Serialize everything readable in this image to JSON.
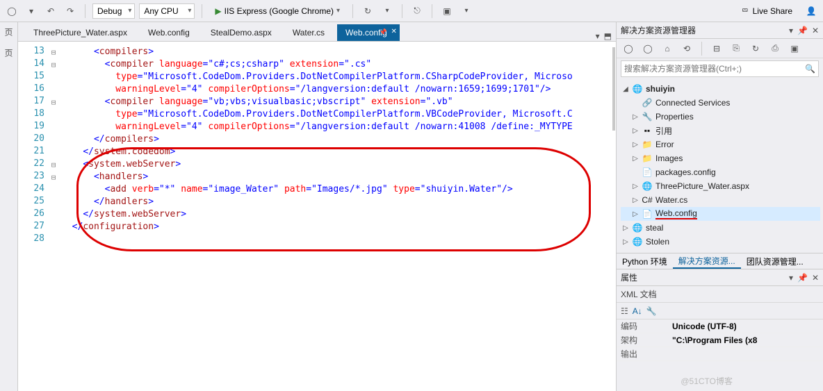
{
  "toolbar": {
    "config": "Debug",
    "platform": "Any CPU",
    "start_label": "IIS Express (Google Chrome)",
    "liveshare": "Live Share"
  },
  "tabs": {
    "items": [
      {
        "label": "ThreePicture_Water.aspx",
        "active": false
      },
      {
        "label": "Web.config",
        "active": false
      },
      {
        "label": "StealDemo.aspx",
        "active": false
      },
      {
        "label": "Water.cs",
        "active": false
      },
      {
        "label": "Web.config",
        "active": true
      }
    ]
  },
  "gutter": {
    "start": 13,
    "end": 28
  },
  "code": {
    "lines": [
      {
        "n": 13,
        "fold": "⊟",
        "ind": 3,
        "tokens": [
          [
            "punc",
            "<"
          ],
          [
            "tag",
            "compilers"
          ],
          [
            "punc",
            ">"
          ]
        ]
      },
      {
        "n": 14,
        "fold": "⊟",
        "ind": 4,
        "tokens": [
          [
            "punc",
            "<"
          ],
          [
            "tag",
            "compiler"
          ],
          [
            "txt",
            " "
          ],
          [
            "attr",
            "language"
          ],
          [
            "punc",
            "="
          ],
          [
            "val",
            "\"c#;cs;csharp\""
          ],
          [
            "txt",
            " "
          ],
          [
            "attr",
            "extension"
          ],
          [
            "punc",
            "="
          ],
          [
            "val",
            "\".cs\""
          ]
        ]
      },
      {
        "n": 15,
        "fold": "",
        "ind": 5,
        "tokens": [
          [
            "attr",
            "type"
          ],
          [
            "punc",
            "="
          ],
          [
            "val",
            "\"Microsoft.CodeDom.Providers.DotNetCompilerPlatform.CSharpCodeProvider, Microso"
          ]
        ]
      },
      {
        "n": 16,
        "fold": "",
        "ind": 5,
        "tokens": [
          [
            "attr",
            "warningLevel"
          ],
          [
            "punc",
            "="
          ],
          [
            "val",
            "\"4\""
          ],
          [
            "txt",
            " "
          ],
          [
            "attr",
            "compilerOptions"
          ],
          [
            "punc",
            "="
          ],
          [
            "val",
            "\"/langversion:default /nowarn:1659;1699;1701\""
          ],
          [
            "punc",
            "/>"
          ]
        ]
      },
      {
        "n": 17,
        "fold": "⊟",
        "ind": 4,
        "tokens": [
          [
            "punc",
            "<"
          ],
          [
            "tag",
            "compiler"
          ],
          [
            "txt",
            " "
          ],
          [
            "attr",
            "language"
          ],
          [
            "punc",
            "="
          ],
          [
            "val",
            "\"vb;vbs;visualbasic;vbscript\""
          ],
          [
            "txt",
            " "
          ],
          [
            "attr",
            "extension"
          ],
          [
            "punc",
            "="
          ],
          [
            "val",
            "\".vb\""
          ]
        ]
      },
      {
        "n": 18,
        "fold": "",
        "ind": 5,
        "tokens": [
          [
            "attr",
            "type"
          ],
          [
            "punc",
            "="
          ],
          [
            "val",
            "\"Microsoft.CodeDom.Providers.DotNetCompilerPlatform.VBCodeProvider, Microsoft.C"
          ]
        ]
      },
      {
        "n": 19,
        "fold": "",
        "ind": 5,
        "tokens": [
          [
            "attr",
            "warningLevel"
          ],
          [
            "punc",
            "="
          ],
          [
            "val",
            "\"4\""
          ],
          [
            "txt",
            " "
          ],
          [
            "attr",
            "compilerOptions"
          ],
          [
            "punc",
            "="
          ],
          [
            "val",
            "\"/langversion:default /nowarn:41008 /define:_MYTYPE"
          ]
        ]
      },
      {
        "n": 20,
        "fold": "",
        "ind": 3,
        "tokens": [
          [
            "punc",
            "</"
          ],
          [
            "tag",
            "compilers"
          ],
          [
            "punc",
            ">"
          ]
        ]
      },
      {
        "n": 21,
        "fold": "",
        "ind": 2,
        "tokens": [
          [
            "punc",
            "</"
          ],
          [
            "tag",
            "system.codedom"
          ],
          [
            "punc",
            ">"
          ]
        ]
      },
      {
        "n": 22,
        "fold": "⊟",
        "ind": 2,
        "tokens": [
          [
            "punc",
            "<"
          ],
          [
            "tag",
            "system.webServer"
          ],
          [
            "punc",
            ">"
          ]
        ]
      },
      {
        "n": 23,
        "fold": "⊟",
        "ind": 3,
        "tokens": [
          [
            "punc",
            "<"
          ],
          [
            "tag",
            "handlers"
          ],
          [
            "punc",
            ">"
          ]
        ]
      },
      {
        "n": 24,
        "fold": "",
        "ind": 4,
        "tokens": [
          [
            "punc",
            "<"
          ],
          [
            "tag",
            "add"
          ],
          [
            "txt",
            " "
          ],
          [
            "attr",
            "verb"
          ],
          [
            "punc",
            "="
          ],
          [
            "val",
            "\"*\""
          ],
          [
            "txt",
            " "
          ],
          [
            "attr",
            "name"
          ],
          [
            "punc",
            "="
          ],
          [
            "val",
            "\"image_Water\""
          ],
          [
            "txt",
            " "
          ],
          [
            "attr",
            "path"
          ],
          [
            "punc",
            "="
          ],
          [
            "val",
            "\"Images/*.jpg\""
          ],
          [
            "txt",
            " "
          ],
          [
            "attr",
            "type"
          ],
          [
            "punc",
            "="
          ],
          [
            "val",
            "\"shuiyin.Water\""
          ],
          [
            "punc",
            "/>"
          ]
        ]
      },
      {
        "n": 25,
        "fold": "",
        "ind": 3,
        "tokens": [
          [
            "punc",
            "</"
          ],
          [
            "tag",
            "handlers"
          ],
          [
            "punc",
            ">"
          ]
        ]
      },
      {
        "n": 26,
        "fold": "",
        "ind": 2,
        "tokens": [
          [
            "punc",
            "</"
          ],
          [
            "tag",
            "system.webServer"
          ],
          [
            "punc",
            ">"
          ]
        ]
      },
      {
        "n": 27,
        "fold": "",
        "ind": 1,
        "tokens": [
          [
            "punc",
            "</"
          ],
          [
            "tag",
            "configuration"
          ],
          [
            "punc",
            ">"
          ]
        ]
      },
      {
        "n": 28,
        "fold": "",
        "ind": 0,
        "tokens": []
      }
    ]
  },
  "solution_explorer": {
    "title": "解决方案资源管理器",
    "search_placeholder": "搜索解决方案资源管理器(Ctrl+;)",
    "tree": [
      {
        "lvl": 0,
        "tw": "◢",
        "ico": "🌐",
        "label": "shuiyin",
        "bold": true
      },
      {
        "lvl": 1,
        "tw": "",
        "ico": "🔗",
        "label": "Connected Services"
      },
      {
        "lvl": 1,
        "tw": "▷",
        "ico": "🔧",
        "label": "Properties"
      },
      {
        "lvl": 1,
        "tw": "▷",
        "ico": "▪▪",
        "label": "引用"
      },
      {
        "lvl": 1,
        "tw": "▷",
        "ico": "📁",
        "label": "Error"
      },
      {
        "lvl": 1,
        "tw": "▷",
        "ico": "📁",
        "label": "Images"
      },
      {
        "lvl": 1,
        "tw": "",
        "ico": "📄",
        "label": "packages.config"
      },
      {
        "lvl": 1,
        "tw": "▷",
        "ico": "🌐",
        "label": "ThreePicture_Water.aspx"
      },
      {
        "lvl": 1,
        "tw": "▷",
        "ico": "C#",
        "label": "Water.cs"
      },
      {
        "lvl": 1,
        "tw": "▷",
        "ico": "📄",
        "label": "Web.config",
        "sel": true,
        "underline": true
      },
      {
        "lvl": 0,
        "tw": "▷",
        "ico": "🌐",
        "label": "steal"
      },
      {
        "lvl": 0,
        "tw": "▷",
        "ico": "🌐",
        "label": "Stolen"
      }
    ]
  },
  "bottom_tabs": {
    "items": [
      "Python 环境",
      "解决方案资源...",
      "团队资源管理..."
    ],
    "active_index": 1
  },
  "properties": {
    "title": "属性",
    "subtitle": "XML 文档",
    "rows": [
      {
        "k": "编码",
        "v": "Unicode (UTF-8)"
      },
      {
        "k": "架构",
        "v": "\"C:\\Program Files (x8"
      },
      {
        "k": "输出",
        "v": ""
      }
    ]
  },
  "watermark": "@51CTO博客"
}
